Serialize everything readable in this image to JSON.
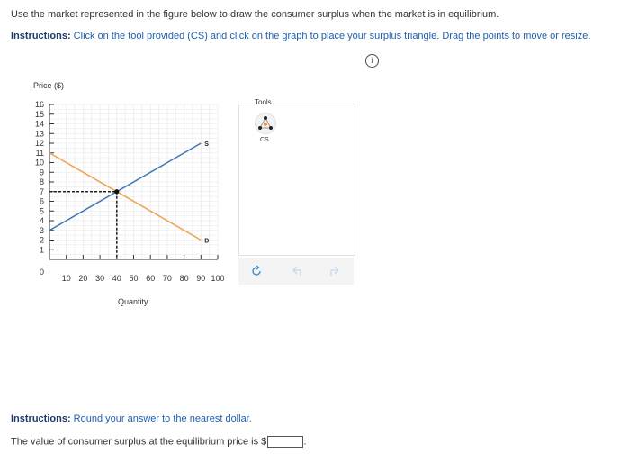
{
  "question": {
    "text": "Use the market represented in the figure below to draw the consumer surplus when the market is in equilibrium.",
    "instructions_1": {
      "label": "Instructions:",
      "text": " Click on the tool provided (CS) and click on the graph to place your surplus triangle. Drag the points to move or resize."
    },
    "instructions_2": {
      "label": "Instructions:",
      "text": " Round your answer to the nearest dollar."
    },
    "answer_prompt": "The value of consumer surplus at the equilibrium price is $",
    "answer_suffix": ".",
    "answer_value": ""
  },
  "info_icon": "info-icon",
  "tools": {
    "title": "Tools",
    "cs_label": "CS",
    "cs_icon": "triangle-points-icon"
  },
  "actions": [
    "reset-icon",
    "undo-icon",
    "redo-icon"
  ],
  "colors": {
    "supply": "#3a78b5",
    "demand": "#f0a050",
    "instruction_label": "#1a3a6b",
    "instruction_text": "#1d5fb0"
  },
  "chart_data": {
    "type": "line",
    "ylabel": "Price ($)",
    "xlabel": "Quantity",
    "x_ticks": [
      10,
      20,
      30,
      40,
      50,
      60,
      70,
      80,
      90,
      100
    ],
    "y_ticks": [
      1,
      2,
      3,
      4,
      5,
      6,
      7,
      8,
      9,
      10,
      11,
      12,
      13,
      14,
      15,
      16
    ],
    "origin_label": "0",
    "xlim": [
      0,
      100
    ],
    "ylim": [
      0,
      16
    ],
    "grid": true,
    "series": [
      {
        "name": "S",
        "points": [
          [
            0,
            3
          ],
          [
            90,
            12
          ]
        ]
      },
      {
        "name": "D",
        "points": [
          [
            0,
            11
          ],
          [
            90,
            2
          ]
        ]
      }
    ],
    "equilibrium": {
      "x": 40,
      "y": 7
    }
  }
}
